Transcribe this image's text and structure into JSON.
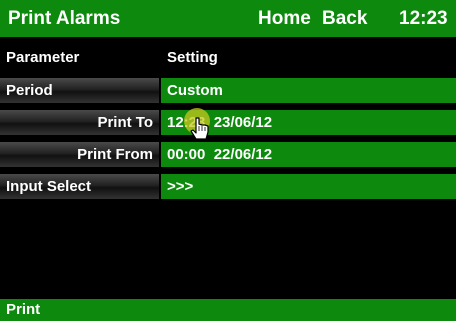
{
  "header": {
    "title": "Print Alarms",
    "home_label": "Home",
    "back_label": "Back",
    "time": "12:23"
  },
  "table": {
    "col_parameter": "Parameter",
    "col_setting": "Setting"
  },
  "rows": [
    {
      "label": "Period",
      "value": "Custom"
    },
    {
      "label": "Print To",
      "time": "12:23",
      "date": "23/06/12"
    },
    {
      "label": "Print From",
      "time": "00:00",
      "date": "22/06/12"
    },
    {
      "label": "Input Select",
      "value": ">>>"
    }
  ],
  "footer": {
    "print_label": "Print"
  },
  "colors": {
    "accent_green": "#0d8a0d",
    "touch_highlight": "#c8c820"
  }
}
